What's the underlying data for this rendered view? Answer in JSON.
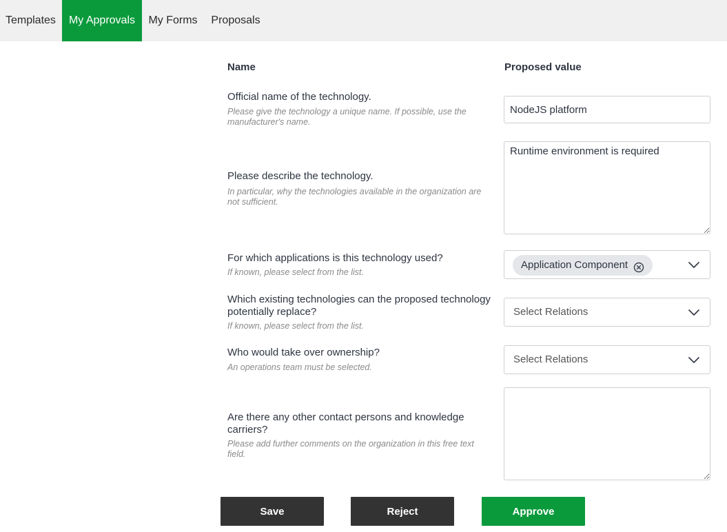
{
  "nav": {
    "tabs": [
      {
        "label": "Templates",
        "active": false
      },
      {
        "label": "My Approvals",
        "active": true
      },
      {
        "label": "My Forms",
        "active": false
      },
      {
        "label": "Proposals",
        "active": false
      }
    ]
  },
  "form": {
    "columns": {
      "name": "Name",
      "value": "Proposed value"
    },
    "questions": [
      {
        "label": "Official name of the technology.",
        "hint": "Please give the technology a unique name. If possible, use the manufacturer's name.",
        "value": "NodeJS platform"
      },
      {
        "label": "Please describe the technology.",
        "hint": "In particular, why the technologies available in the organization are not sufficient.",
        "value": "Runtime environment is required"
      },
      {
        "label": "For which applications is this technology used?",
        "hint": "If known, please select from the list.",
        "chips": [
          "Application Component"
        ]
      },
      {
        "label": "Which existing technologies can the proposed technology potentially replace?",
        "hint": "If known, please select from the list.",
        "placeholder": "Select Relations"
      },
      {
        "label": "Who would take over ownership?",
        "hint": "An operations team must be selected.",
        "placeholder": "Select Relations"
      },
      {
        "label": "Are there any other contact persons and knowledge carriers?",
        "hint": "Please add further comments on the organization in this free text field.",
        "value": ""
      }
    ]
  },
  "actions": {
    "save": "Save",
    "reject": "Reject",
    "approve": "Approve"
  },
  "colors": {
    "accent": "#0a9a3c",
    "dark_button": "#333333",
    "nav_bg": "#f0f0f0"
  },
  "icons": {
    "chevron": "chevron-down-icon",
    "chip_remove": "close-circle-icon",
    "resize": "resize-grip-icon"
  }
}
